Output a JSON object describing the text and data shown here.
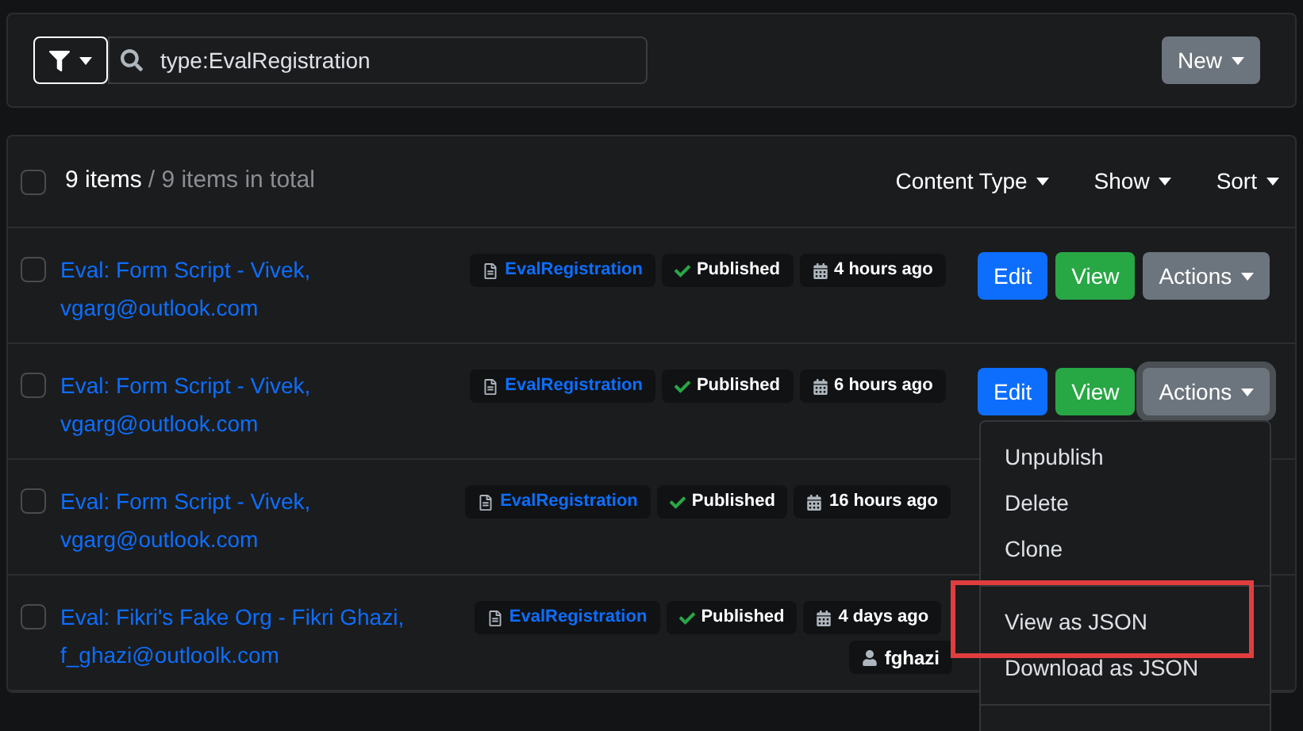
{
  "search": {
    "value": "type:EvalRegistration"
  },
  "new_button": "New",
  "list_header": {
    "checked": false,
    "count": "9 items",
    "total": "/ 9 items in total",
    "menus": [
      "Content Type",
      "Show",
      "Sort"
    ]
  },
  "rows": [
    {
      "checked": false,
      "title": "Eval: Form Script - Vivek, vgarg@outlook.com",
      "type": "EvalRegistration",
      "status": "Published",
      "time": "4 hours ago",
      "actions": [
        "Edit",
        "View",
        "Actions"
      ],
      "menu_open": false
    },
    {
      "checked": false,
      "title": "Eval: Form Script - Vivek, vgarg@outlook.com",
      "type": "EvalRegistration",
      "status": "Published",
      "time": "6 hours ago",
      "actions": [
        "Edit",
        "View",
        "Actions"
      ],
      "menu_open": true
    },
    {
      "checked": false,
      "title": "Eval: Form Script - Vivek, vgarg@outlook.com",
      "type": "EvalRegistration",
      "status": "Published",
      "time": "16 hours ago"
    },
    {
      "checked": false,
      "title": "Eval: Fikri's Fake Org - Fikri Ghazi, f_ghazi@outloolk.com",
      "type": "EvalRegistration",
      "status": "Published",
      "time": "4 days ago",
      "owner": "fghazi"
    }
  ],
  "actions_menu": [
    {
      "items": [
        {
          "label": "Unpublish",
          "highlighted": false
        },
        {
          "label": "Delete",
          "highlighted": false
        },
        {
          "label": "Clone",
          "highlighted": false
        }
      ]
    },
    {
      "items": [
        {
          "label": "View as JSON",
          "highlighted": true
        },
        {
          "label": "Download as JSON",
          "highlighted": false
        }
      ]
    }
  ]
}
